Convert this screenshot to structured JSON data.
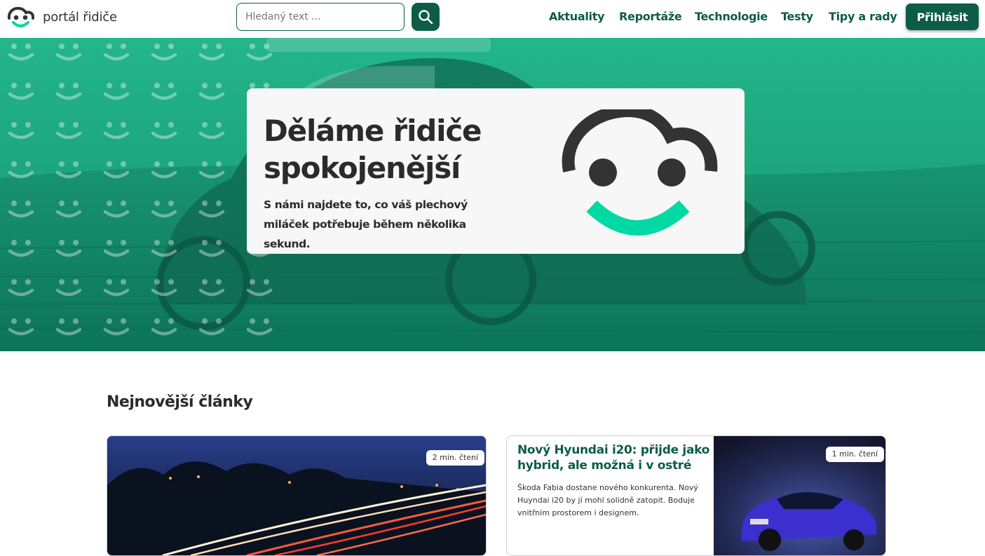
{
  "header": {
    "logo_text": "portál řidiče",
    "search": {
      "placeholder": "Hledaný text ...",
      "value": ""
    },
    "search_icon": "search-icon",
    "nav": [
      {
        "label": "Aktuality"
      },
      {
        "label": "Reportáže"
      },
      {
        "label": "Technologie"
      },
      {
        "label": "Testy"
      },
      {
        "label": "Tipy a rady"
      }
    ],
    "login_label": "Přihlásit"
  },
  "hero": {
    "title": "Děláme řidiče spokojenější",
    "subtitle": "S námi najdete to, co váš plechový miláček potřebuje během několika sekund."
  },
  "articles": {
    "section_title": "Nejnovější články",
    "items": [
      {
        "read_time": "2 min. čtení"
      },
      {
        "title": "Nový Hyundai i20: přijde jako hybrid, ale možná i v ostré",
        "excerpt": "Škoda Fabia dostane nového konkurenta. Nový Huyndai i20 by jí mohl solidně zatopit. Boduje vnitřním prostorem i designem.",
        "read_time": "1 min. čtení"
      }
    ]
  },
  "colors": {
    "brand_dark": "#0d5c47",
    "brand_mint": "#00d9a4",
    "hero_overlay": "#1a9572"
  }
}
